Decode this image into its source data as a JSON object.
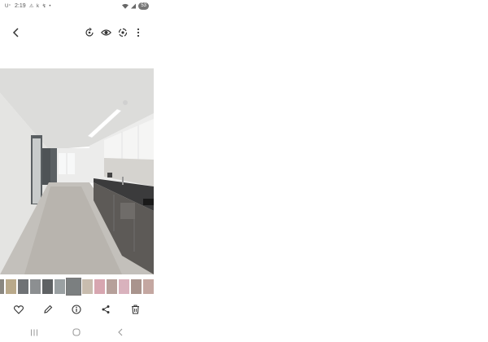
{
  "status_bar": {
    "time": "2:19",
    "left_icons": "⚠ k ↯ •",
    "left_prefix": "U⁺",
    "battery": "53"
  },
  "top_bar": {
    "icons": [
      "back-arrow-icon",
      "remaster-icon",
      "eye-icon",
      "shape-icon",
      "more-vert-icon"
    ]
  },
  "photo": {
    "description_name": "kitchen-hallway-photo"
  },
  "thumbnails": {
    "count": 15,
    "selected_index": 6
  },
  "actions": {
    "icons": [
      "heart-icon",
      "edit-pencil-icon",
      "info-icon",
      "share-icon",
      "trash-icon"
    ]
  },
  "nav_bar": {
    "icons": [
      "recent-apps-icon",
      "home-icon",
      "back-nav-icon"
    ]
  },
  "colors": {
    "icon": "#333333",
    "nav_icon": "#9a9a9a",
    "floor": "#bdbab5",
    "wall": "#e6e6e4",
    "counter": "#3a3a3a",
    "cabinet": "#f4f4f4"
  }
}
